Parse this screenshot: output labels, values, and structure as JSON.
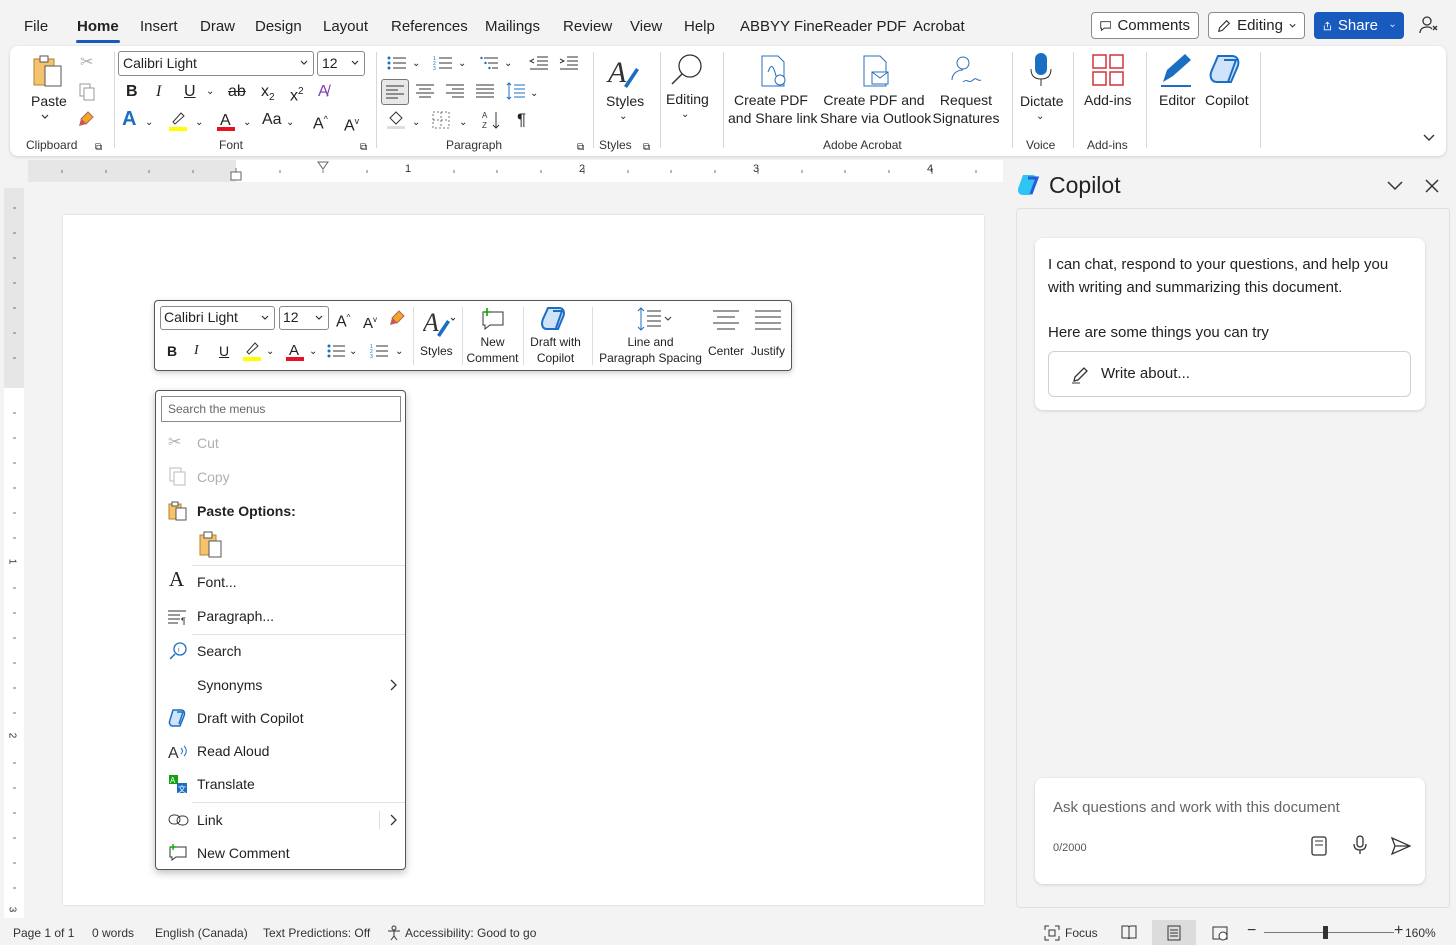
{
  "menubar": {
    "tabs": [
      "File",
      "Home",
      "Insert",
      "Draw",
      "Design",
      "Layout",
      "References",
      "Mailings",
      "Review",
      "View",
      "Help",
      "ABBYY FineReader PDF",
      "Acrobat"
    ],
    "comments_label": "Comments",
    "editing_label": "Editing",
    "share_label": "Share"
  },
  "ribbon": {
    "clipboard": {
      "paste_label": "Paste",
      "group_label": "Clipboard"
    },
    "font": {
      "font_name": "Calibri Light",
      "font_size": "12",
      "group_label": "Font",
      "change_case": "Aa"
    },
    "paragraph": {
      "group_label": "Paragraph"
    },
    "styles": {
      "styles_label": "Styles",
      "group_label": "Styles"
    },
    "editing": {
      "label": "Editing"
    },
    "acrobat": {
      "create_pdf_line1": "Create PDF",
      "create_pdf_line2": "and Share link",
      "create_outlook_line1": "Create PDF and",
      "create_outlook_line2": "Share via Outlook",
      "request_line1": "Request",
      "request_line2": "Signatures",
      "group_label": "Adobe Acrobat"
    },
    "voice": {
      "dictate_label": "Dictate",
      "group_label": "Voice"
    },
    "addins": {
      "addins_label": "Add-ins",
      "group_label": "Add-ins"
    },
    "editor_label": "Editor",
    "copilot_label": "Copilot"
  },
  "ruler": {
    "numbers": [
      "1",
      "2",
      "3",
      "4"
    ],
    "vnumbers": [
      "1",
      "2",
      "3"
    ]
  },
  "mini_toolbar": {
    "font_name": "Calibri Light",
    "font_size": "12",
    "styles_label": "Styles",
    "new_comment_line1": "New",
    "new_comment_line2": "Comment",
    "draft_line1": "Draft with",
    "draft_line2": "Copilot",
    "spacing_line1": "Line and",
    "spacing_line2": "Paragraph Spacing",
    "center_label": "Center",
    "justify_label": "Justify"
  },
  "context_menu": {
    "search_placeholder": "Search the menus",
    "items": [
      {
        "label": "Cut"
      },
      {
        "label": "Copy"
      },
      {
        "label": "Paste Options:"
      },
      {
        "label": "Font..."
      },
      {
        "label": "Paragraph..."
      },
      {
        "label": "Search"
      },
      {
        "label": "Synonyms"
      },
      {
        "label": "Draft with Copilot"
      },
      {
        "label": "Read Aloud"
      },
      {
        "label": "Translate"
      },
      {
        "label": "Link"
      },
      {
        "label": "New Comment"
      }
    ]
  },
  "copilot": {
    "title": "Copilot",
    "intro": "I can chat, respond to your questions, and help you with writing and summarizing this document.",
    "try_heading": "Here are some things you can try",
    "write_about": "Write about...",
    "ask_placeholder": "Ask questions and work with this document",
    "char_count": "0/2000"
  },
  "status_bar": {
    "page": "Page 1 of 1",
    "words": "0 words",
    "language": "English (Canada)",
    "predictions": "Text Predictions: Off",
    "accessibility": "Accessibility: Good to go",
    "focus": "Focus",
    "zoom": "160%"
  },
  "colors": {
    "accent": "#185abd",
    "highlight": "#ffff00",
    "font_red": "#e81123",
    "copilot_blue": "#0f6cbd"
  }
}
